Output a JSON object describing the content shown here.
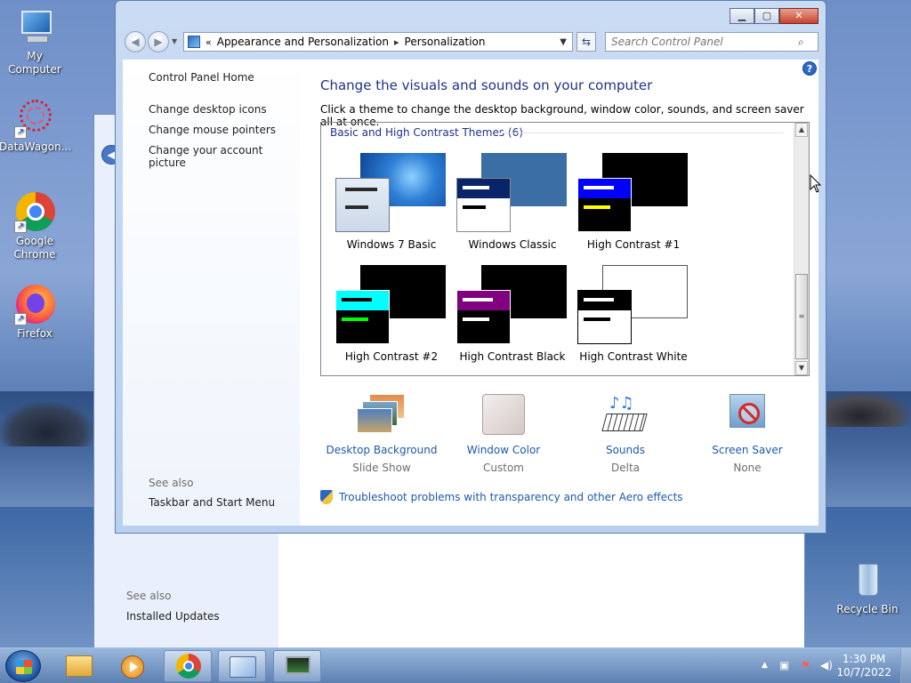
{
  "desktop": {
    "icons": [
      {
        "label": "My Computer"
      },
      {
        "label": "DataWagon..."
      },
      {
        "label": "Google Chrome"
      },
      {
        "label": "Firefox"
      },
      {
        "label": "Recycle Bin"
      }
    ]
  },
  "back_window": {
    "see_also": "See also",
    "installed_updates": "Installed Updates"
  },
  "window": {
    "breadcrumb": [
      "Appearance and Personalization",
      "Personalization"
    ],
    "search_placeholder": "Search Control Panel",
    "sidebar": {
      "home": "Control Panel Home",
      "links": [
        "Change desktop icons",
        "Change mouse pointers",
        "Change your account picture"
      ],
      "see_also": "See also",
      "see_also_links": [
        "Taskbar and Start Menu"
      ]
    },
    "main": {
      "title": "Change the visuals and sounds on your computer",
      "subtitle": "Click a theme to change the desktop background, window color, sounds, and screen saver all at once.",
      "group_header": "Basic and High Contrast Themes (6)",
      "themes": [
        {
          "label": "Windows 7 Basic",
          "bg": "#1f6fc9",
          "fg": "#d8e2ee",
          "bar1": "#2b2b2b",
          "bar2": "#2b2b2b"
        },
        {
          "label": "Windows Classic",
          "bg": "#3a6ea5",
          "fg": "#ffffff",
          "head": "#0a246a",
          "bar1": "#ffffff",
          "bar2": "#000000"
        },
        {
          "label": "High Contrast #1",
          "bg": "#000000",
          "fg": "#000000",
          "head": "#0000ff",
          "bar1": "#ffffff",
          "bar2": "#ffff00"
        },
        {
          "label": "High Contrast #2",
          "bg": "#000000",
          "fg": "#000000",
          "head": "#00ffff",
          "bar1": "#000000",
          "bar2": "#00ff00"
        },
        {
          "label": "High Contrast Black",
          "bg": "#000000",
          "fg": "#000000",
          "head": "#800080",
          "bar1": "#ffffff",
          "bar2": "#ffffff"
        },
        {
          "label": "High Contrast White",
          "bg": "#ffffff",
          "fg": "#ffffff",
          "head": "#000000",
          "bar1": "#ffffff",
          "bar2": "#000000"
        }
      ],
      "bottom": [
        {
          "name": "Desktop Background",
          "value": "Slide Show",
          "icon": "desktop-background-icon"
        },
        {
          "name": "Window Color",
          "value": "Custom",
          "icon": "window-color-icon"
        },
        {
          "name": "Sounds",
          "value": "Delta",
          "icon": "sounds-icon"
        },
        {
          "name": "Screen Saver",
          "value": "None",
          "icon": "screen-saver-icon"
        }
      ],
      "troubleshoot": "Troubleshoot problems with transparency and other Aero effects"
    }
  },
  "taskbar": {
    "time": "1:30 PM",
    "date": "10/7/2022"
  }
}
